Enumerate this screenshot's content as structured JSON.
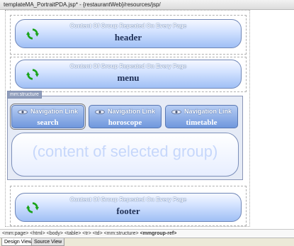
{
  "window": {
    "title": "templateMA_PortraitPDA.jsp* - {restaurantWeb}/resources/jsp/"
  },
  "groups": {
    "header": {
      "subtitle": "Content Of Group Repeated On Every Page",
      "name": "header"
    },
    "menu": {
      "subtitle": "Content Of Group Repeated On Every Page",
      "name": "menu"
    },
    "footer": {
      "subtitle": "Content Of Group Repeated On Every Page",
      "name": "footer"
    }
  },
  "structure": {
    "label": "mm:structure",
    "links": [
      {
        "title": "Navigation Link",
        "value": "search"
      },
      {
        "title": "Navigation Link",
        "value": "horoscope"
      },
      {
        "title": "Navigation Link",
        "value": "timetable"
      }
    ],
    "content_placeholder": "(content of selected group)"
  },
  "status_path": {
    "prefix": "<mm:page> <html> <body> <table> <tr> <td> <mm:structure> ",
    "current": "<mmgroup-ref>"
  },
  "view_tabs": {
    "design": "Design View",
    "source": "Source View"
  },
  "colors": {
    "accent": "#6f97dd",
    "content_text": "#c6d7fb"
  },
  "icons": {
    "group": "refresh-icon",
    "link": "eye-icon"
  }
}
